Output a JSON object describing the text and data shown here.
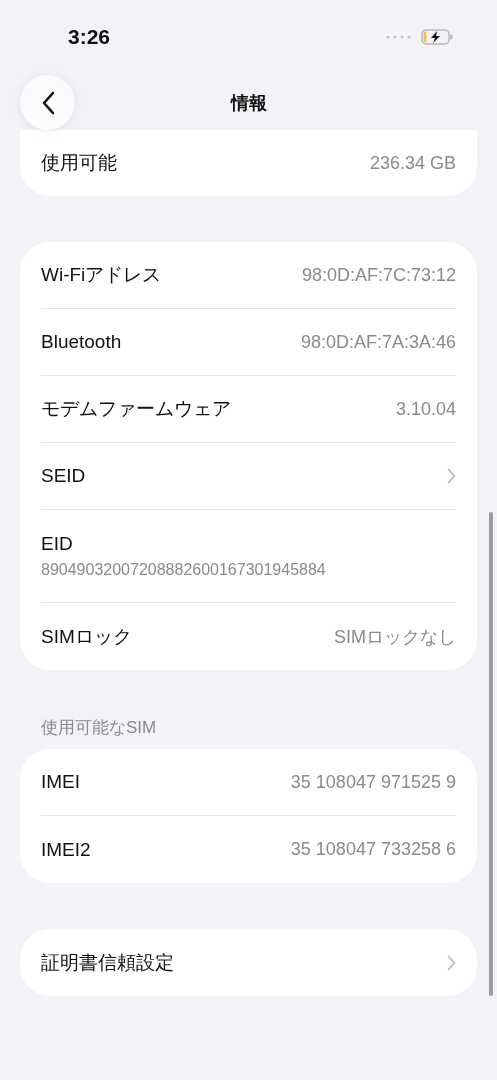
{
  "status_bar": {
    "time": "3:26"
  },
  "nav": {
    "title": "情報"
  },
  "groups": [
    {
      "rows": [
        {
          "kind": "value",
          "label": "使用可能",
          "value": "236.34 GB"
        }
      ]
    },
    {
      "rows": [
        {
          "kind": "value",
          "label": "Wi-Fiアドレス",
          "value": "98:0D:AF:7C:73:12"
        },
        {
          "kind": "value",
          "label": "Bluetooth",
          "value": "98:0D:AF:7A:3A:46"
        },
        {
          "kind": "value",
          "label": "モデムファームウェア",
          "value": "3.10.04"
        },
        {
          "kind": "chevron",
          "label": "SEID"
        },
        {
          "kind": "stacked",
          "label": "EID",
          "value": "89049032007208882600167301945884"
        },
        {
          "kind": "value",
          "label": "SIMロック",
          "value": "SIMロックなし"
        }
      ]
    },
    {
      "header": "使用可能なSIM",
      "rows": [
        {
          "kind": "value",
          "label": "IMEI",
          "value": "35 108047 971525 9"
        },
        {
          "kind": "value",
          "label": "IMEI2",
          "value": "35 108047 733258 6"
        }
      ]
    },
    {
      "rows": [
        {
          "kind": "chevron",
          "label": "証明書信頼設定"
        }
      ]
    }
  ]
}
